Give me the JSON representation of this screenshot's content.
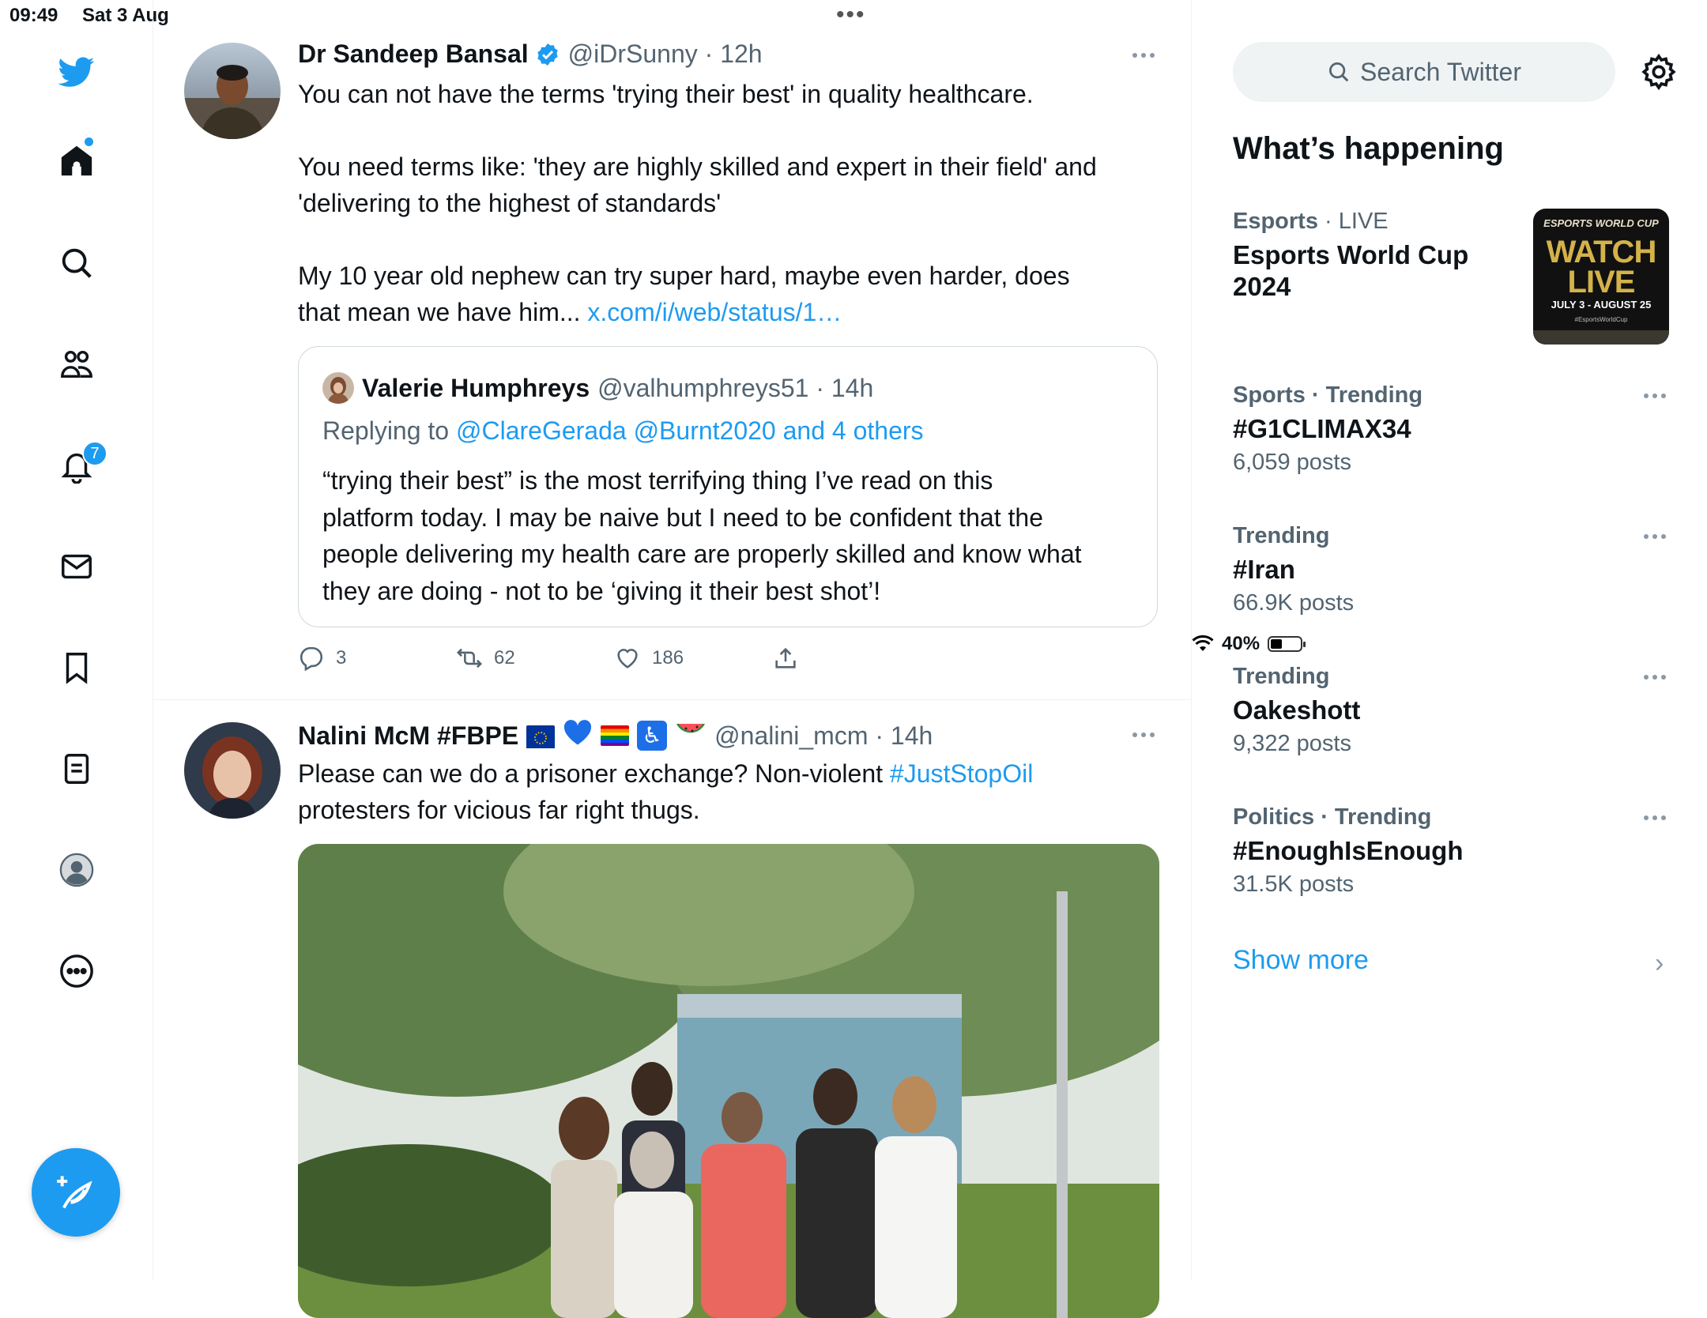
{
  "status_bar": {
    "time": "09:49",
    "date": "Sat 3 Aug",
    "battery": "40%",
    "battery_level": 0.4
  },
  "nav": {
    "items": [
      "twitter-logo",
      "home",
      "explore",
      "communities",
      "notifications",
      "messages",
      "bookmarks",
      "lists",
      "profile",
      "more"
    ],
    "notifications_badge": "7"
  },
  "tweets": [
    {
      "name": "Dr Sandeep Bansal",
      "verified": true,
      "meta": "@iDrSunny · 12h",
      "text_lines": [
        "You can not have the terms 'trying their best' in quality healthcare.",
        "You need terms like: 'they are highly skilled and expert in their field' and",
        "'delivering to the highest of standards'",
        "My 10 year old nephew can try super hard, maybe even harder, does",
        "that mean we have him..."
      ],
      "link": "x.com/i/web/status/1…",
      "quote": {
        "name": "Valerie Humphreys",
        "meta": "@valhumphreys51 · 14h",
        "replying_prefix": "Replying to",
        "replying_targets": "@ClareGerada @Burnt2020 and 4 others",
        "text_lines": [
          "“trying their best” is the most terrifying thing I’ve read on this",
          "platform today. I may be naive but I need to be confident that the",
          "people delivering my health care are properly skilled and know what",
          "they are doing - not to be ‘giving it their best shot’!"
        ]
      },
      "replies": "3",
      "retweets": "62",
      "likes": "186"
    },
    {
      "name": "Nalini McM #FBPE",
      "emojis": [
        "eu-flag",
        "blue-heart",
        "rainbow-flag",
        "wheelchair",
        "watermelon"
      ],
      "meta": "@nalini_mcm · 14h",
      "text_before": "Please can we do a prisoner exchange? Non-violent",
      "hashtag": "#JustStopOil",
      "text_after": "protesters for vicious far right thugs."
    }
  ],
  "sidebar": {
    "search_placeholder": "Search Twitter",
    "title": "What’s happening",
    "trends": [
      {
        "context_bold": "Esports",
        "context_rest": " · LIVE",
        "title": "Esports World Cup 2024",
        "count": ""
      },
      {
        "context_bold": "Sports · Trending",
        "context_rest": "",
        "title": "#G1CLIMAX34",
        "count": "6,059 posts"
      },
      {
        "context_bold": "Trending",
        "context_rest": "",
        "title": "#Iran",
        "count": "66.9K posts"
      },
      {
        "context_bold": "Trending",
        "context_rest": "",
        "title": "Oakeshott",
        "count": "9,322 posts"
      },
      {
        "context_bold": "Politics · Trending",
        "context_rest": "",
        "title": "#EnoughIsEnough",
        "count": "31.5K posts"
      }
    ],
    "esports_thumb": {
      "top": "ESPORTS WORLD CUP",
      "main": "WATCH LIVE",
      "dates": "JULY 3 - AUGUST 25",
      "tag": "#EsportsWorldCup"
    },
    "show_more": "Show more"
  },
  "colors": {
    "accent": "#1d9bf0",
    "text": "#0f1419",
    "muted": "#536471"
  }
}
